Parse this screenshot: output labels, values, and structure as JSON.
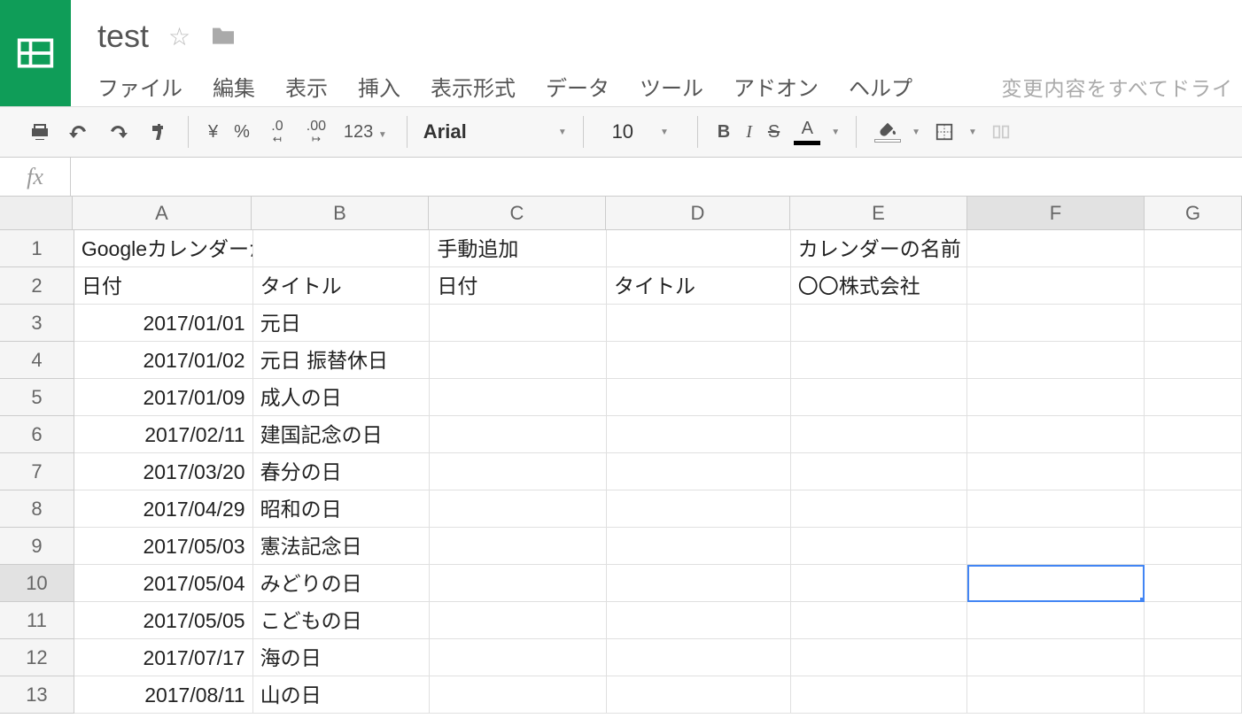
{
  "doc": {
    "title": "test"
  },
  "menu": {
    "file": "ファイル",
    "edit": "編集",
    "view": "表示",
    "insert": "挿入",
    "format": "表示形式",
    "data": "データ",
    "tools": "ツール",
    "addons": "アドオン",
    "help": "ヘルプ"
  },
  "status": "変更内容をすべてドライ",
  "toolbar": {
    "currency": "¥",
    "percent": "%",
    "dec_dec": ".0",
    "dec_inc": ".00",
    "formats": "123",
    "font": "Arial",
    "size": "10",
    "bold": "B",
    "italic": "I",
    "strike": "S",
    "textcolor": "A"
  },
  "fx": {
    "label": "fx"
  },
  "columns": [
    "A",
    "B",
    "C",
    "D",
    "E",
    "F",
    "G"
  ],
  "selected": {
    "col": "F",
    "row": 10
  },
  "rows": [
    {
      "n": 1,
      "A": "Googleカレンダーからの取得",
      "B": "",
      "C": "手動追加",
      "D": "",
      "E": "カレンダーの名前",
      "F": "",
      "G": ""
    },
    {
      "n": 2,
      "A": "日付",
      "B": "タイトル",
      "C": "日付",
      "D": "タイトル",
      "E": "〇〇株式会社",
      "F": "",
      "G": ""
    },
    {
      "n": 3,
      "A": "2017/01/01",
      "B": "元日",
      "C": "",
      "D": "",
      "E": "",
      "F": "",
      "G": "",
      "Ar": true
    },
    {
      "n": 4,
      "A": "2017/01/02",
      "B": "元日 振替休日",
      "C": "",
      "D": "",
      "E": "",
      "F": "",
      "G": "",
      "Ar": true
    },
    {
      "n": 5,
      "A": "2017/01/09",
      "B": "成人の日",
      "C": "",
      "D": "",
      "E": "",
      "F": "",
      "G": "",
      "Ar": true
    },
    {
      "n": 6,
      "A": "2017/02/11",
      "B": "建国記念の日",
      "C": "",
      "D": "",
      "E": "",
      "F": "",
      "G": "",
      "Ar": true
    },
    {
      "n": 7,
      "A": "2017/03/20",
      "B": "春分の日",
      "C": "",
      "D": "",
      "E": "",
      "F": "",
      "G": "",
      "Ar": true
    },
    {
      "n": 8,
      "A": "2017/04/29",
      "B": "昭和の日",
      "C": "",
      "D": "",
      "E": "",
      "F": "",
      "G": "",
      "Ar": true
    },
    {
      "n": 9,
      "A": "2017/05/03",
      "B": "憲法記念日",
      "C": "",
      "D": "",
      "E": "",
      "F": "",
      "G": "",
      "Ar": true
    },
    {
      "n": 10,
      "A": "2017/05/04",
      "B": "みどりの日",
      "C": "",
      "D": "",
      "E": "",
      "F": "",
      "G": "",
      "Ar": true
    },
    {
      "n": 11,
      "A": "2017/05/05",
      "B": "こどもの日",
      "C": "",
      "D": "",
      "E": "",
      "F": "",
      "G": "",
      "Ar": true
    },
    {
      "n": 12,
      "A": "2017/07/17",
      "B": "海の日",
      "C": "",
      "D": "",
      "E": "",
      "F": "",
      "G": "",
      "Ar": true
    },
    {
      "n": 13,
      "A": "2017/08/11",
      "B": "山の日",
      "C": "",
      "D": "",
      "E": "",
      "F": "",
      "G": "",
      "Ar": true
    }
  ]
}
